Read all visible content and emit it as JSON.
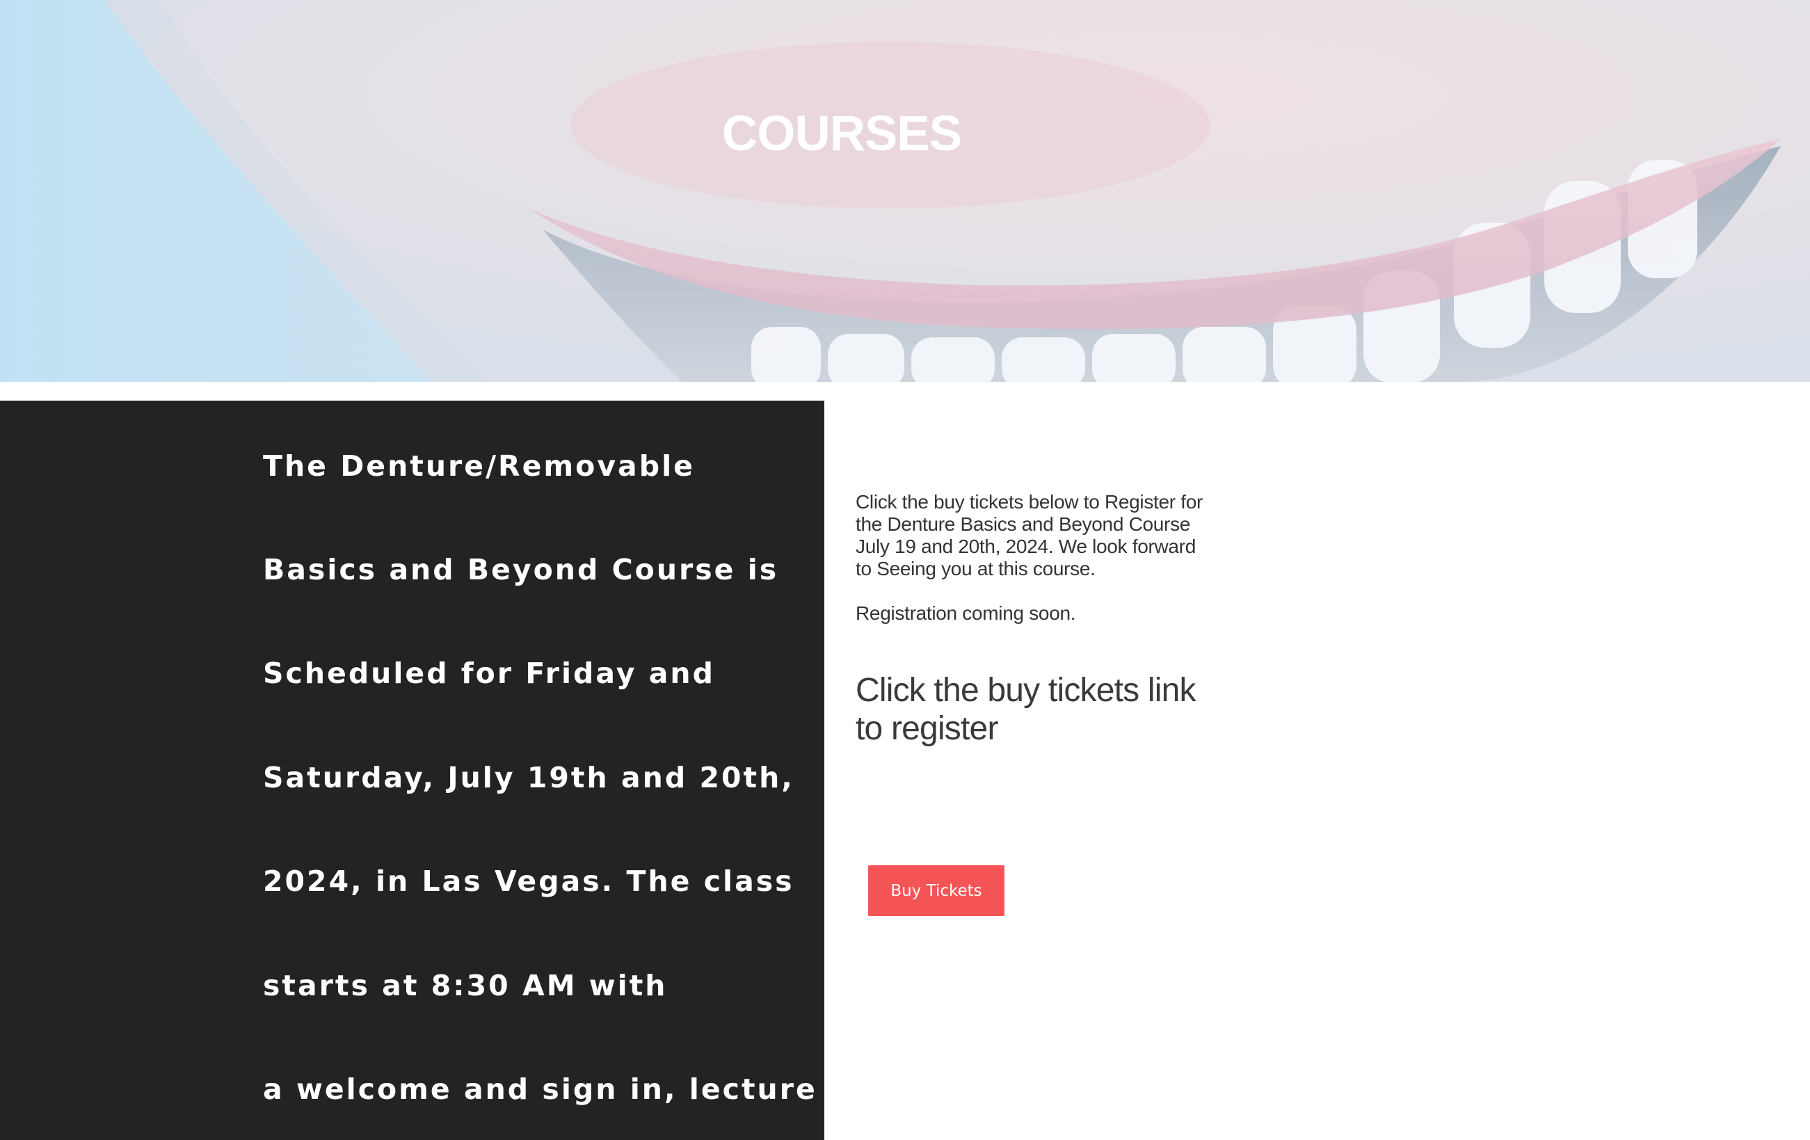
{
  "hero": {
    "title": "COURSES"
  },
  "course_description": {
    "lines": [
      "The Denture/Removable",
      "Basics and Beyond Course is",
      "Scheduled for Friday and",
      "Saturday, July 19th and 20th,",
      "2024, in Las Vegas. The class",
      "starts at 8:30 AM with",
      "a welcome and sign in, lecture"
    ]
  },
  "registration": {
    "intro_lines": [
      "Click the buy tickets below to Register for",
      "the Denture Basics and Beyond Course",
      "July 19 and 20th, 2024. We look forward",
      "to Seeing you at this course."
    ],
    "status": "Registration coming soon.",
    "heading_lines": [
      "Click the buy tickets link",
      "to register"
    ],
    "button_label": "Buy Tickets"
  },
  "colors": {
    "dark_panel": "#232323",
    "button": "#f55456",
    "text": "#333333"
  }
}
